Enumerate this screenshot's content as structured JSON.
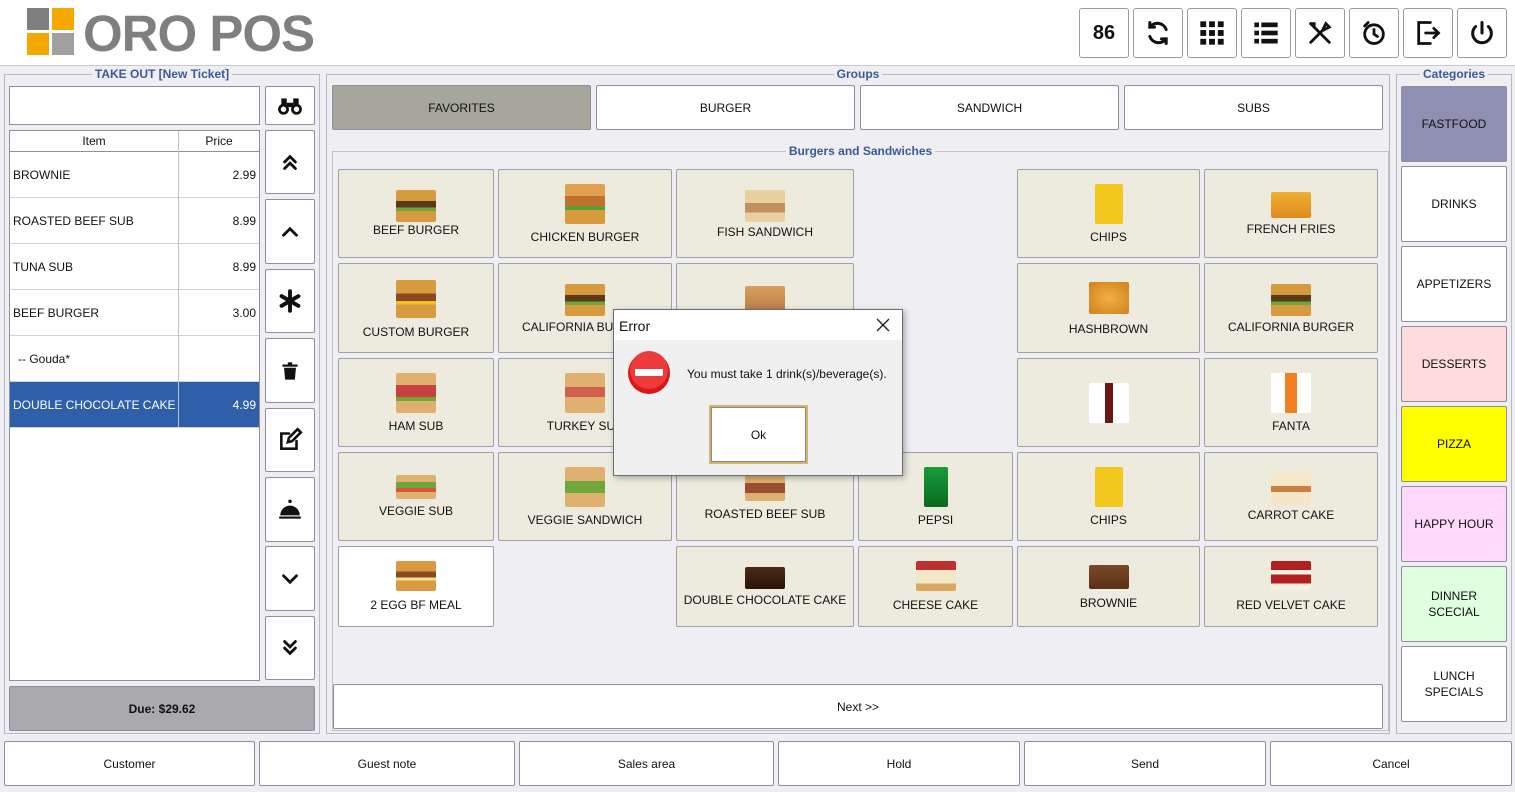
{
  "app": {
    "logo_text": "ORO POS",
    "logo_colors": [
      "#7f7f7f",
      "#f5a800",
      "#f5a800",
      "#a0a0a0"
    ]
  },
  "header": {
    "count_badge": "86"
  },
  "ticket": {
    "panel_title": "TAKE OUT [New Ticket]",
    "search_value": "",
    "columns": {
      "item": "Item",
      "price": "Price"
    },
    "rows": [
      {
        "item": "BROWNIE",
        "price": "2.99"
      },
      {
        "item": "ROASTED BEEF SUB",
        "price": "8.99"
      },
      {
        "item": "TUNA SUB",
        "price": "8.99"
      },
      {
        "item": "BEEF BURGER",
        "price": "3.00"
      },
      {
        "item": "-- Gouda*",
        "price": ""
      },
      {
        "item": "DOUBLE CHOCOLATE CAKE",
        "price": "4.99"
      }
    ],
    "due": "Due: $29.62",
    "selected_color": "#2e5fa8"
  },
  "groups": {
    "panel_title": "Groups",
    "items": [
      "FAVORITES",
      "BURGER",
      "SANDWICH",
      "SUBS"
    ]
  },
  "menu": {
    "panel_title": "Burgers and Sandwiches",
    "items": [
      "BEEF BURGER",
      "CHICKEN BURGER",
      "FISH SANDWICH",
      "CHIPS",
      "FRENCH FRIES",
      "CUSTOM BURGER",
      "CALIFORNIA BURGER",
      "HASHBROWN",
      "CALIFORNIA BURGER",
      "HAM SUB",
      "TURKEY SUB",
      "FANTA",
      "VEGGIE SUB",
      "VEGGIE SANDWICH",
      "ROASTED BEEF SUB",
      "PEPSI",
      "CHIPS",
      "CARROT CAKE",
      "2 EGG BF MEAL",
      "DOUBLE CHOCOLATE CAKE",
      "CHEESE CAKE",
      "BROWNIE",
      "RED VELVET CAKE"
    ],
    "next_label": "Next >>"
  },
  "categories": {
    "panel_title": "Categories",
    "items": [
      {
        "label": "FASTFOOD",
        "color": "#8e8fb3"
      },
      {
        "label": "DRINKS",
        "color": "#ffffff"
      },
      {
        "label": "APPETIZERS",
        "color": "#ffffff"
      },
      {
        "label": "DESSERTS",
        "color": "#ffdcdc"
      },
      {
        "label": "PIZZA",
        "color": "#ffff00"
      },
      {
        "label": "HAPPY HOUR",
        "color": "#ffd9fb"
      },
      {
        "label": "DINNER SCECIAL",
        "color": "#dfffdf"
      },
      {
        "label": "LUNCH SPECIALS",
        "color": "#ffffff"
      }
    ]
  },
  "bottom": [
    "Customer",
    "Guest note",
    "Sales area",
    "Hold",
    "Send",
    "Cancel"
  ],
  "dialog": {
    "title": "Error",
    "message": "You must take 1 drink(s)/beverage(s).",
    "ok_label": "Ok"
  }
}
